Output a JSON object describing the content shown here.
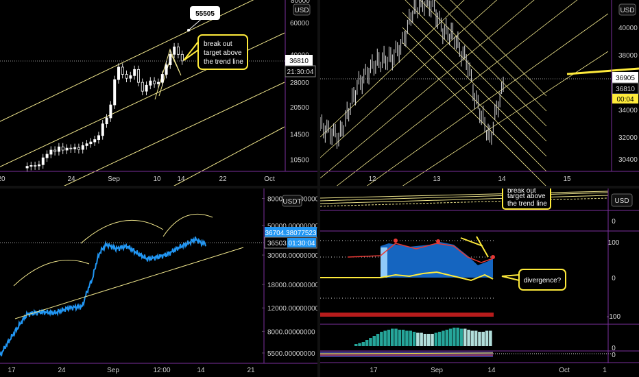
{
  "colors": {
    "background": "#000000",
    "trend": "#f0e68c",
    "grid_purple": "#7b2f9e",
    "price_line": "#2196f3",
    "up_candle": "#ffffff",
    "histogram": "#26a69a",
    "callout_border": "#ffeb3b"
  },
  "charts": {
    "c1": {
      "currency": "USD",
      "price_tag": "36810",
      "countdown": "21:30:04",
      "callout_target": "55505",
      "callout_text": [
        "break out",
        "target above",
        "the trend line"
      ]
    },
    "c2": {
      "currency": "USD",
      "price_tag_1": "36905",
      "price_tag_2": "36810",
      "countdown": "00:04"
    },
    "c3": {
      "currency": "USDT",
      "price_tag_1": "36704.38077523",
      "price_tag_2": "36503.",
      "countdown": "01:30:04"
    },
    "c4": {
      "currency": "USD",
      "mini_callout_text": [
        "break out",
        "target above",
        "the trend line"
      ],
      "divergence_label": "divergence?"
    }
  },
  "chart_data": [
    {
      "type": "line",
      "title": "",
      "representation": "candlestick",
      "log_scale": true,
      "x_ticks": [
        "20",
        "24",
        "Sep",
        "10",
        "14",
        "22",
        "Oct"
      ],
      "y_ticks": [
        10500,
        14500,
        20500,
        28000,
        40000,
        60000
      ],
      "y_top_label": "80000",
      "closes": [
        9600,
        9700,
        9650,
        9800,
        10700,
        11200,
        11800,
        11600,
        12300,
        11800,
        12100,
        12000,
        12200,
        11900,
        12500,
        12800,
        13100,
        13500,
        14200,
        16500,
        17800,
        21000,
        29000,
        34000,
        31000,
        29500,
        30500,
        33000,
        28000,
        25000,
        27000,
        28500,
        27500,
        28000,
        31000,
        35000,
        40000,
        44000,
        40000,
        36810
      ],
      "callout_target": 55505,
      "last_price": 36810,
      "ylim": [
        9000,
        80000
      ]
    },
    {
      "type": "line",
      "title": "",
      "representation": "bars",
      "x_ticks": [
        "12",
        "13",
        "14",
        "15"
      ],
      "y_ticks": [
        30400,
        32000,
        34000,
        36000,
        38000,
        40000
      ],
      "last_price": 36810,
      "ylim": [
        29500,
        42000
      ]
    },
    {
      "type": "line",
      "title": "",
      "log_scale": true,
      "x_ticks": [
        "17",
        "24",
        "Sep",
        "12:00",
        "14",
        "21"
      ],
      "y_ticks": [
        5500,
        8000,
        12000,
        18000,
        30000,
        50000,
        80000
      ],
      "y_label_decimals": 8,
      "last_price": 36704.38077523,
      "ylim": [
        4600,
        95000
      ]
    },
    {
      "type": "line",
      "title": "",
      "x_ticks": [
        "17",
        "Sep",
        "14",
        "Oct",
        "1"
      ],
      "oscillator_y_ticks": [
        100,
        0,
        -100
      ],
      "histogram_values": [
        2,
        3,
        4,
        6,
        8,
        10,
        12,
        14,
        15,
        16,
        17,
        17,
        16,
        16,
        15,
        15,
        14,
        13,
        13,
        12,
        12,
        12,
        13,
        14,
        15,
        16,
        17,
        18,
        18,
        17,
        17,
        16,
        15,
        15,
        14,
        14,
        15,
        15
      ]
    }
  ]
}
